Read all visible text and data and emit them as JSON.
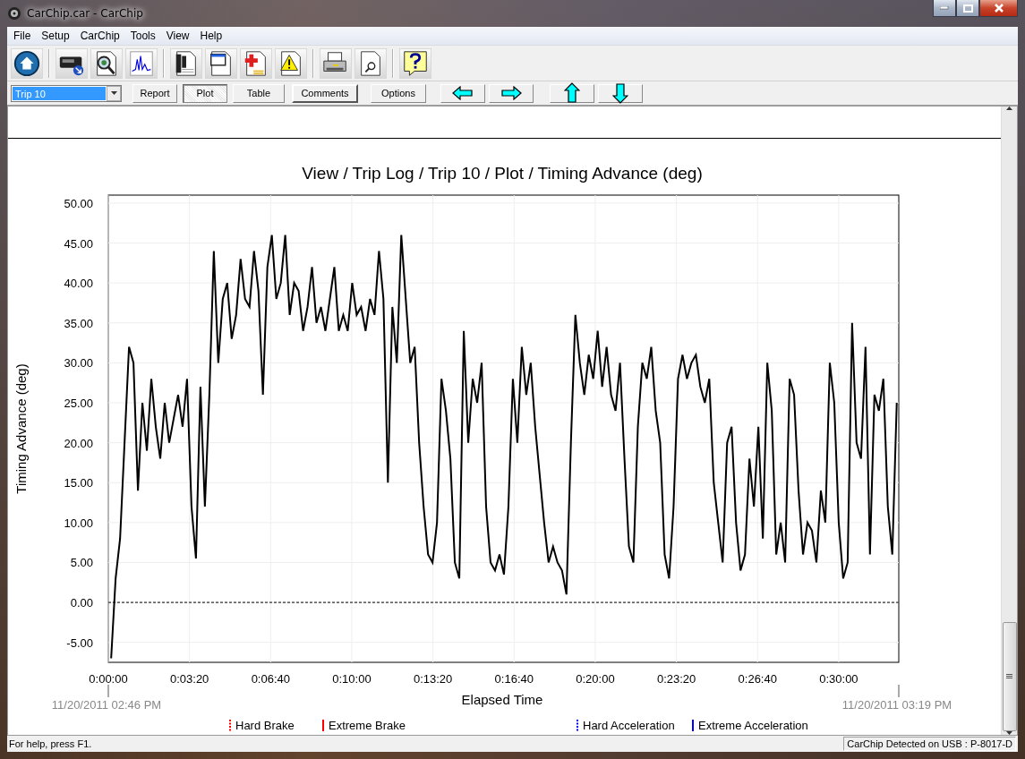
{
  "window": {
    "title": "CarChip.car - CarChip"
  },
  "menu": [
    "File",
    "Setup",
    "CarChip",
    "Tools",
    "View",
    "Help"
  ],
  "trip_selector": {
    "value": "Trip 10"
  },
  "view_buttons": [
    {
      "label": "Report",
      "selected": false
    },
    {
      "label": "Plot",
      "selected": true
    },
    {
      "label": "Table",
      "selected": false
    }
  ],
  "action_buttons": [
    {
      "label": "Comments",
      "default": true
    },
    {
      "label": "Options",
      "default": false
    }
  ],
  "chart": {
    "chart_data": {
      "type": "line",
      "title": "View / Trip Log / Trip 10 / Plot / Timing Advance (deg)",
      "xlabel": "Elapsed Time",
      "ylabel": "Timing Advance (deg)",
      "x": [
        7,
        18,
        29,
        40,
        51,
        62,
        73,
        84,
        95,
        106,
        117,
        128,
        139,
        150,
        161,
        172,
        183,
        194,
        205,
        216,
        227,
        238,
        249,
        260,
        271,
        282,
        293,
        304,
        315,
        326,
        337,
        348,
        359,
        370,
        381,
        392,
        403,
        414,
        425,
        436,
        447,
        458,
        469,
        480,
        491,
        502,
        513,
        524,
        535,
        546,
        557,
        568,
        579,
        590,
        601,
        612,
        623,
        634,
        645,
        656,
        667,
        678,
        689,
        700,
        711,
        722,
        733,
        744,
        755,
        766,
        777,
        788,
        799,
        810,
        821,
        832,
        843,
        854,
        865,
        876,
        887,
        898,
        909,
        920,
        931,
        942,
        953,
        964,
        975,
        986,
        997,
        1008,
        1019,
        1030,
        1041,
        1052,
        1063,
        1074,
        1085,
        1096,
        1107,
        1118,
        1129,
        1140,
        1151,
        1162,
        1173,
        1184,
        1195,
        1206,
        1217,
        1228,
        1239,
        1250,
        1261,
        1272,
        1283,
        1294,
        1305,
        1316,
        1327,
        1338,
        1349,
        1360,
        1371,
        1382,
        1393,
        1404,
        1415,
        1426,
        1437,
        1448,
        1459,
        1470,
        1481,
        1492,
        1503,
        1514,
        1525,
        1536,
        1547,
        1558,
        1569,
        1580,
        1591,
        1602,
        1613,
        1624,
        1635,
        1646,
        1657,
        1668,
        1679,
        1690,
        1701,
        1712,
        1723,
        1734,
        1745,
        1756,
        1767,
        1778,
        1789,
        1800,
        1811,
        1822,
        1833,
        1844,
        1855,
        1866,
        1877,
        1888,
        1899,
        1910,
        1921,
        1932,
        1943
      ],
      "grid": true,
      "ref_lines": [
        {
          "axis": "y",
          "value": 0
        }
      ],
      "series": [
        {
          "color": "#000000",
          "values": [
            -7,
            3,
            8,
            20,
            32,
            30,
            14,
            25,
            19,
            28,
            22,
            18,
            25,
            20,
            23,
            26,
            22,
            28,
            12,
            5.5,
            27,
            12,
            26,
            44,
            30,
            38,
            40,
            33,
            36,
            43,
            38,
            37,
            44,
            39,
            26,
            42,
            46,
            38,
            40,
            46,
            36,
            40,
            39,
            34,
            37,
            42,
            35,
            37,
            34,
            38,
            42,
            34,
            36,
            34,
            40,
            36,
            37,
            34,
            38,
            36,
            44,
            38,
            15,
            37,
            30,
            46,
            38,
            30,
            32,
            20,
            12,
            6,
            5,
            10,
            28,
            24,
            18,
            5,
            3,
            34,
            20,
            28,
            25,
            30,
            12,
            5,
            4,
            6,
            3.5,
            12,
            28,
            20,
            32,
            26,
            30,
            22,
            16,
            10,
            5,
            7,
            5,
            4,
            1,
            20,
            36,
            30,
            26,
            31,
            28,
            34,
            27,
            32,
            26,
            24,
            30,
            18,
            7,
            5,
            22,
            30,
            28,
            32,
            24,
            20,
            6,
            3,
            12,
            28,
            31,
            28,
            30,
            31,
            27,
            25,
            28,
            15,
            10,
            5,
            20,
            22,
            10,
            4,
            6,
            18,
            12,
            22,
            8,
            30,
            24,
            6,
            10,
            5,
            28,
            26,
            14,
            6,
            10,
            9,
            5,
            14,
            10,
            30,
            25,
            10,
            3,
            5,
            35,
            20,
            18,
            32,
            6,
            26,
            24,
            28,
            12,
            6,
            25
          ]
        }
      ],
      "xlim": [
        0,
        1948
      ],
      "ylim": [
        -7.5,
        51
      ],
      "xticks": [
        {
          "value": 0,
          "label": "0:00:00"
        },
        {
          "value": 200,
          "label": "0:03:20"
        },
        {
          "value": 400,
          "label": "0:06:40"
        },
        {
          "value": 600,
          "label": "0:10:00"
        },
        {
          "value": 800,
          "label": "0:13:20"
        },
        {
          "value": 1000,
          "label": "0:16:40"
        },
        {
          "value": 1200,
          "label": "0:20:00"
        },
        {
          "value": 1400,
          "label": "0:23:20"
        },
        {
          "value": 1600,
          "label": "0:26:40"
        },
        {
          "value": 1800,
          "label": "0:30:00"
        }
      ],
      "yticks": [
        {
          "value": -5,
          "label": "-5.00"
        },
        {
          "value": 0,
          "label": "0.00"
        },
        {
          "value": 5,
          "label": "5.00"
        },
        {
          "value": 10,
          "label": "10.00"
        },
        {
          "value": 15,
          "label": "15.00"
        },
        {
          "value": 20,
          "label": "20.00"
        },
        {
          "value": 25,
          "label": "25.00"
        },
        {
          "value": 30,
          "label": "30.00"
        },
        {
          "value": 35,
          "label": "35.00"
        },
        {
          "value": 40,
          "label": "40.00"
        },
        {
          "value": 45,
          "label": "45.00"
        },
        {
          "value": 50,
          "label": "50.00"
        }
      ]
    },
    "start_time": "11/20/2011 02:46 PM",
    "end_time": "11/20/2011 03:19 PM",
    "legend": [
      {
        "label": "Hard Brake",
        "color": "#ff0000",
        "kind": "dashed"
      },
      {
        "label": "Extreme Brake",
        "color": "#ff0000",
        "kind": "solid"
      },
      {
        "label": "Hard Acceleration",
        "color": "#0000ff",
        "kind": "dashed"
      },
      {
        "label": "Extreme Acceleration",
        "color": "#0000ff",
        "kind": "solid"
      }
    ]
  },
  "status_bar": {
    "help": "For help, press F1.",
    "device": "CarChip Detected on USB : P-8017-D"
  }
}
